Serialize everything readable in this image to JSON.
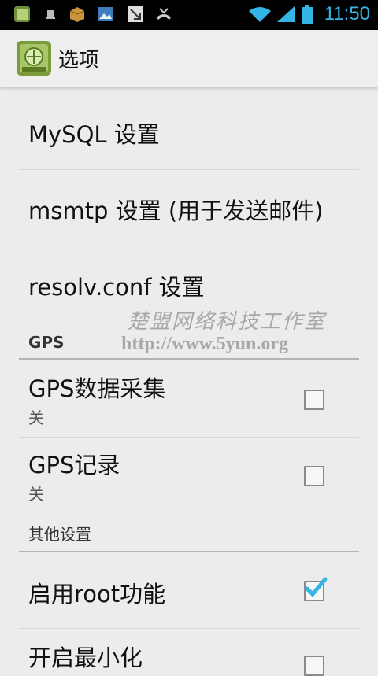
{
  "status_bar": {
    "time": "11:50",
    "left_icons": [
      "app-notification-icon",
      "usb-icon",
      "package-icon",
      "image-icon",
      "download-icon",
      "missed-call-icon"
    ],
    "right_icons": [
      "wifi-icon",
      "signal-icon",
      "battery-icon"
    ]
  },
  "action_bar": {
    "title": "选项",
    "app_icon": "settings-app-icon"
  },
  "items": [
    {
      "title": "MySQL 设置"
    },
    {
      "title": "msmtp 设置 (用于发送邮件)"
    },
    {
      "title": "resolv.conf 设置"
    }
  ],
  "categories": {
    "gps": "GPS",
    "other": "其他设置"
  },
  "gps_items": [
    {
      "title": "GPS数据采集",
      "summary": "关",
      "checked": false
    },
    {
      "title": "GPS记录",
      "summary": "关",
      "checked": false
    }
  ],
  "other_items": [
    {
      "title": "启用root功能",
      "checked": true
    },
    {
      "title": "开启最小化",
      "checked": false
    }
  ],
  "watermark": {
    "line1": "楚盟网络科技工作室",
    "line2": "http://www.5yun.org"
  },
  "colors": {
    "accent": "#33b5e5",
    "check": "#33b5e5"
  }
}
